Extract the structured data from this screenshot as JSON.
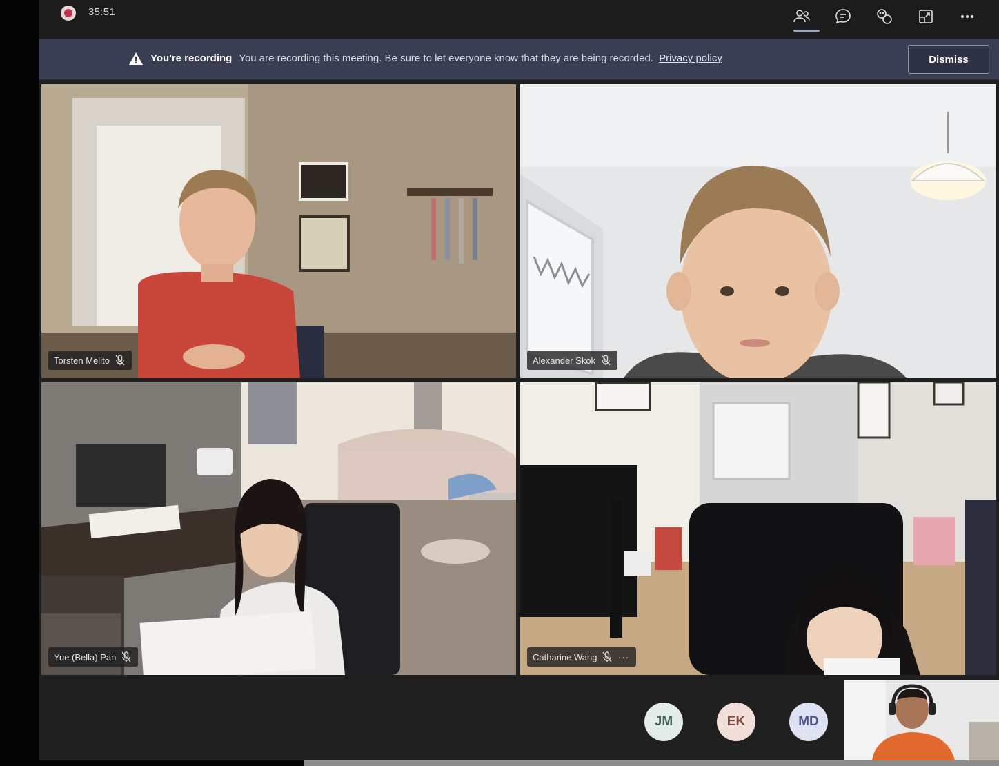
{
  "topbar": {
    "timer": "35:51",
    "buttons": [
      {
        "name": "participants",
        "active": true
      },
      {
        "name": "chat"
      },
      {
        "name": "reactions"
      },
      {
        "name": "share"
      },
      {
        "name": "more"
      }
    ]
  },
  "banner": {
    "title": "You're recording",
    "message": "You are recording this meeting. Be sure to let everyone know that they are being recorded.",
    "link": "Privacy policy",
    "dismiss": "Dismiss"
  },
  "participants": [
    {
      "name": "Torsten Melito",
      "muted": true
    },
    {
      "name": "Alexander Skok",
      "muted": true
    },
    {
      "name": "Yue (Bella) Pan",
      "muted": true
    },
    {
      "name": "Catharine Wang",
      "muted": true,
      "more": "···"
    }
  ],
  "avatars": [
    {
      "initials": "JM"
    },
    {
      "initials": "EK"
    },
    {
      "initials": "MD"
    }
  ],
  "colors": {
    "recording": "#c4314b",
    "banner": "#3b3f54",
    "app_bg": "#1f1f1f"
  }
}
